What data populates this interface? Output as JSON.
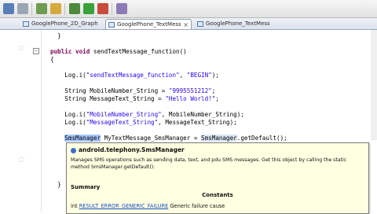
{
  "toolbar": {
    "buttons": [
      "save-icon",
      "print-icon",
      "new-icon",
      "open-icon",
      "debug-icon",
      "run-icon",
      "stop-icon",
      "search-icon"
    ]
  },
  "tabs": [
    {
      "label": "GooglePhone_2D_Graph",
      "active": false
    },
    {
      "label": "GooglePhone_TextMess",
      "active": true
    },
    {
      "label": "GooglePhone_TextMess",
      "active": false
    }
  ],
  "code": {
    "line0": "}",
    "line1_kw1": "public",
    "line1_kw2": "void",
    "line1_rest": " sendTextMessage_function()",
    "line2": "{",
    "line3_a": "Log.i(",
    "line3_s1": "\"sendTextMessage_function\"",
    "line3_b": ", ",
    "line3_s2": "\"BEGIN\"",
    "line3_c": ");",
    "line4_a": "String MobileNumber_String = ",
    "line4_s": "\"9995551212\"",
    "line4_c": ";",
    "line5_a": "String MessageText_String = ",
    "line5_s": "\"Hello World!\"",
    "line5_c": ";",
    "line6_a": "Log.i(",
    "line6_s": "\"MobileNumber_String\"",
    "line6_c": ", MobileNumber_String);",
    "line7_a": "Log.i(",
    "line7_s": "\"MessageText_String\"",
    "line7_c": ", MessageText_String);",
    "line8_sel": "SmsManager",
    "line8_mid": " MyTextMessage_SmsManager = ",
    "line8_hl": "SmsManager",
    "line8_end": ".getDefault();",
    "line9": "}"
  },
  "tooltip": {
    "title": "android.telephony.SmsManager",
    "description": "Manages SMS operations such as sending data, text, and pdu SMS messages. Get this object by calling the static method SmsManager.getDefault().",
    "summary": "Summary",
    "constants": "Constants",
    "row_type": "int",
    "row_link": "RESULT_ERROR_GENERIC_FAILURE",
    "row_desc": "Generic failure cause"
  }
}
